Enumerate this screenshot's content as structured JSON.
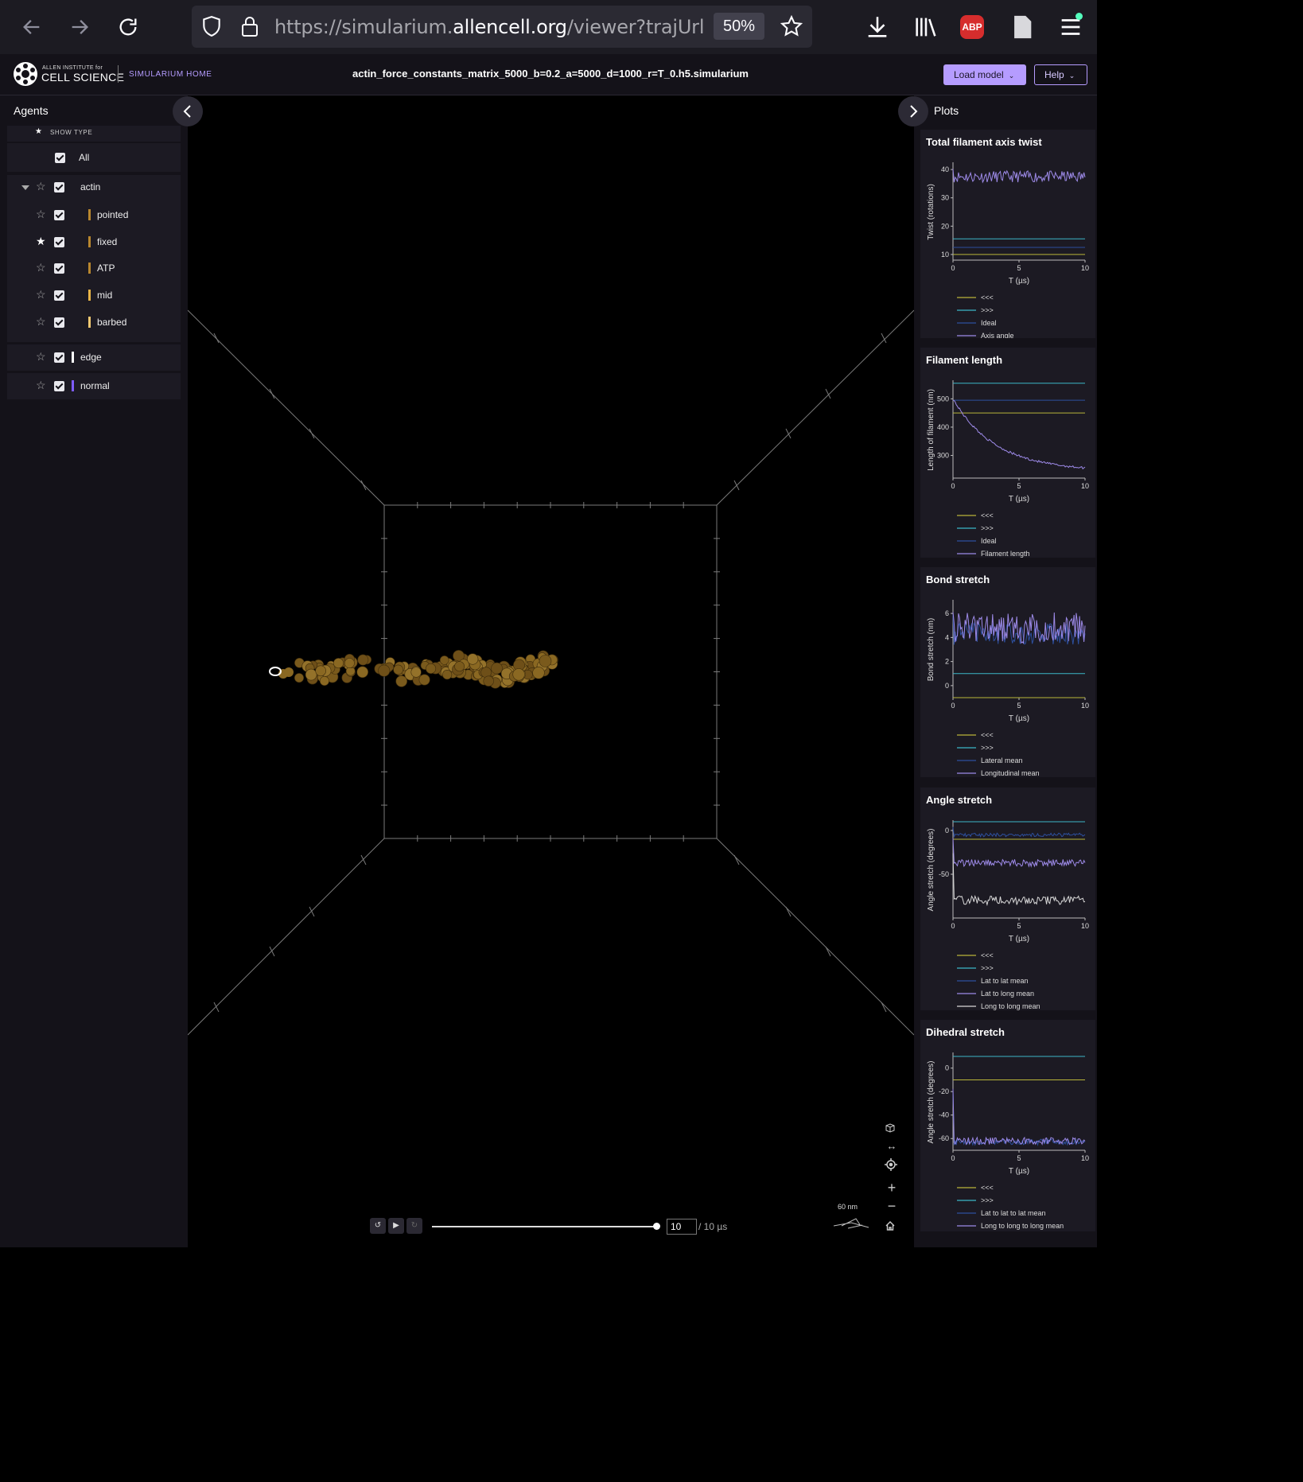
{
  "browser": {
    "url_prefix": "https://simularium.",
    "url_domain": "allencell.org",
    "url_suffix": "/viewer?trajUrl=http",
    "zoom": "50%",
    "adblock": "ABP"
  },
  "header": {
    "logo_small": "ALLEN INSTITUTE for",
    "logo_big": "CELL SCIENCE",
    "home_link": "SIMULARIUM HOME",
    "file_title": "actin_force_constants_matrix_5000_b=0.2_a=5000_d=1000_r=T_0.h5.simularium",
    "load_model": "Load model",
    "help": "Help"
  },
  "agents": {
    "title": "Agents",
    "show_type": "SHOW TYPE",
    "all_label": "All",
    "groups": [
      {
        "label": "actin",
        "color": "",
        "starred": false,
        "children": [
          {
            "label": "pointed",
            "color": "#b8862e",
            "starred": false
          },
          {
            "label": "fixed",
            "color": "#b8862e",
            "starred": true
          },
          {
            "label": "ATP",
            "color": "#b8862e",
            "starred": false
          },
          {
            "label": "mid",
            "color": "#e8b447",
            "starred": false
          },
          {
            "label": "barbed",
            "color": "#f0c872",
            "starred": false
          }
        ]
      },
      {
        "label": "edge",
        "color": "#ffffff",
        "starred": false,
        "children": []
      },
      {
        "label": "normal",
        "color": "#7e5cff",
        "starred": false,
        "children": []
      }
    ]
  },
  "viewer": {
    "scale_bar": "60 nm",
    "time_value": "10",
    "time_total": "/ 10 µs",
    "controls": [
      "cube-icon",
      "pan-icon",
      "focus-icon",
      "zoom-in-icon",
      "zoom-out-icon",
      "home-icon"
    ]
  },
  "plots": {
    "title": "Plots",
    "colors": {
      "yellow": "#b8b53a",
      "cyan": "#3bb6c7",
      "navy": "#2d4f9e",
      "purple": "#9d8ae8",
      "white": "#d8d8d8"
    },
    "items": [
      {
        "title": "Total filament axis twist",
        "ylabel": "Twist (rotations)",
        "xlabel": "T (µs)",
        "yticks": [
          "40",
          "30",
          "20",
          "10"
        ],
        "xticks": [
          "0",
          "5",
          "10"
        ],
        "legend": [
          "<<<",
          ">>>",
          "Ideal",
          "Axis angle"
        ],
        "chart_data": {
          "type": "line",
          "ylim": [
            8,
            42
          ],
          "xlim": [
            0,
            10
          ],
          "series": [
            {
              "name": "<<<",
              "values": [
                10,
                10
              ]
            },
            {
              "name": ">>>",
              "values": [
                15.5,
                15.5
              ]
            },
            {
              "name": "Ideal",
              "values": [
                12.5,
                12.5
              ]
            },
            {
              "name": "Axis angle",
              "noisy": true,
              "mean": 37.5,
              "amp": 2.0
            }
          ]
        }
      },
      {
        "title": "Filament length",
        "ylabel": "Length of filament (nm)",
        "xlabel": "T (µs)",
        "yticks": [
          "500",
          "400",
          "300"
        ],
        "xticks": [
          "0",
          "5",
          "10"
        ],
        "legend": [
          "<<<",
          ">>>",
          "Ideal",
          "Filament length"
        ],
        "chart_data": {
          "type": "line",
          "ylim": [
            220,
            560
          ],
          "xlim": [
            0,
            10
          ],
          "series": [
            {
              "name": "<<<",
              "values": [
                450,
                450
              ]
            },
            {
              "name": ">>>",
              "values": [
                555,
                555
              ]
            },
            {
              "name": "Ideal",
              "values": [
                495,
                495
              ]
            },
            {
              "name": "Filament length",
              "decay": true,
              "start": 500,
              "end": 245
            }
          ]
        }
      },
      {
        "title": "Bond stretch",
        "ylabel": "Bond stretch (nm)",
        "xlabel": "T (µs)",
        "yticks": [
          "6",
          "4",
          "2",
          "0"
        ],
        "xticks": [
          "0",
          "5",
          "10"
        ],
        "legend": [
          "<<<",
          ">>>",
          "Lateral mean",
          "Longitudinal mean"
        ],
        "chart_data": {
          "type": "line",
          "ylim": [
            -1,
            7
          ],
          "xlim": [
            0,
            10
          ],
          "series": [
            {
              "name": "<<<",
              "values": [
                -1,
                -1
              ]
            },
            {
              "name": ">>>",
              "values": [
                1,
                1
              ]
            },
            {
              "name": "Lateral mean",
              "noisy": true,
              "mean": 4.3,
              "amp": 0.9
            },
            {
              "name": "Longitudinal mean",
              "noisy": true,
              "mean": 4.8,
              "amp": 1.3
            }
          ]
        }
      },
      {
        "title": "Angle stretch",
        "ylabel": "Angle stretch (degrees)",
        "xlabel": "T (µs)",
        "yticks": [
          "0",
          "-50"
        ],
        "xticks": [
          "0",
          "5",
          "10"
        ],
        "legend": [
          "<<<",
          ">>>",
          "Lat to lat mean",
          "Lat to long mean",
          "Long to long mean"
        ],
        "chart_data": {
          "type": "line",
          "ylim": [
            -100,
            10
          ],
          "xlim": [
            0,
            10
          ],
          "series": [
            {
              "name": "<<<",
              "values": [
                -10,
                -10
              ]
            },
            {
              "name": ">>>",
              "values": [
                10,
                10
              ]
            },
            {
              "name": "Lat to lat mean",
              "noisy": true,
              "mean": -5,
              "amp": 2
            },
            {
              "name": "Lat to long mean",
              "noisy": true,
              "mean": -37,
              "amp": 4
            },
            {
              "name": "Long to long mean",
              "noisy": true,
              "mean": -80,
              "amp": 5
            }
          ]
        }
      },
      {
        "title": "Dihedral stretch",
        "ylabel": "Angle stretch (degrees)",
        "xlabel": "T (µs)",
        "yticks": [
          "0",
          "-20",
          "-40",
          "-60"
        ],
        "xticks": [
          "0",
          "5",
          "10"
        ],
        "legend": [
          "<<<",
          ">>>",
          "Lat to lat to lat mean",
          "Long to long to long mean"
        ],
        "chart_data": {
          "type": "line",
          "ylim": [
            -70,
            12
          ],
          "xlim": [
            0,
            10
          ],
          "series": [
            {
              "name": "<<<",
              "values": [
                -10,
                -10
              ]
            },
            {
              "name": ">>>",
              "values": [
                10,
                10
              ]
            },
            {
              "name": "Lat to lat to lat mean",
              "noisy": true,
              "mean": -63,
              "amp": 2.5
            },
            {
              "name": "Long to long to long mean",
              "noisy": true,
              "mean": -62,
              "amp": 3
            }
          ]
        }
      }
    ]
  }
}
